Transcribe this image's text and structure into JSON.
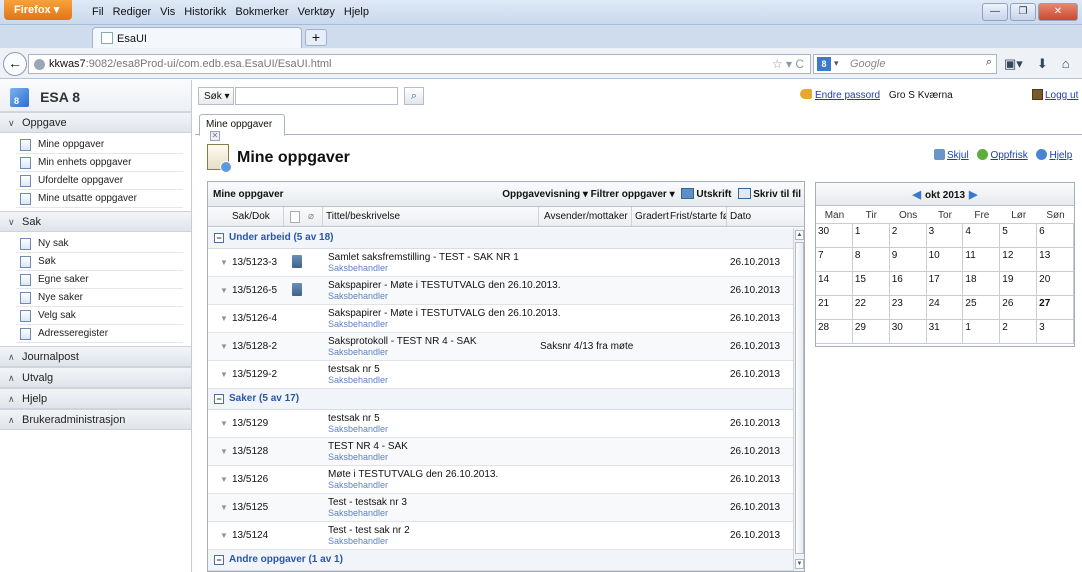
{
  "browser": {
    "menu_button": "Firefox",
    "menu_items": [
      "Fil",
      "Rediger",
      "Vis",
      "Historikk",
      "Bokmerker",
      "Verktøy",
      "Hjelp"
    ],
    "tab_title": "EsaUI",
    "new_tab": "+",
    "url_domain": "kkwas7",
    "url_path": ":9082/esa8Prod-ui/com.edb.esa.EsaUI/EsaUI.html",
    "search_placeholder": "Google"
  },
  "app": {
    "brand_name": "ESA 8",
    "brand_badge": "8",
    "search_select": "Søk",
    "change_password": "Endre passord",
    "user_name": "Gro S Kværna",
    "logout": "Logg ut"
  },
  "sidebar": {
    "sections": [
      {
        "label": "Oppgave",
        "expanded": true,
        "items": [
          "Mine oppgaver",
          "Min enhets oppgaver",
          "Ufordelte oppgaver",
          "Mine utsatte oppgaver"
        ]
      },
      {
        "label": "Sak",
        "expanded": true,
        "items": [
          "Ny sak",
          "Søk",
          "Egne saker",
          "Nye saker",
          "Velg sak",
          "Adresseregister"
        ]
      },
      {
        "label": "Journalpost",
        "expanded": false
      },
      {
        "label": "Utvalg",
        "expanded": false
      },
      {
        "label": "Hjelp",
        "expanded": false
      },
      {
        "label": "Brukeradministrasjon",
        "expanded": false
      }
    ]
  },
  "content": {
    "tab_label": "Mine oppgaver",
    "page_title": "Mine oppgaver",
    "actions": {
      "hide": "Skjul",
      "refresh": "Oppfrisk",
      "help": "Hjelp"
    }
  },
  "grid": {
    "title": "Mine oppgaver",
    "tools": {
      "view": "Oppgavevisning",
      "filter": "Filtrer oppgaver",
      "print": "Utskrift",
      "write": "Skriv til fil"
    },
    "columns": [
      "Sak/Dok",
      "Tittel/beskrivelse",
      "Avsender/mottaker",
      "Gradert",
      "Frist/starte før",
      "Dato"
    ],
    "groups": [
      {
        "label": "Under arbeid (5 av 18)",
        "rows": [
          {
            "saknr": "13/5123-3",
            "stack": true,
            "title": "Samlet saksfremstilling - TEST - SAK NR 1",
            "sub": "Saksbehandler",
            "avs": "",
            "dato": "26.10.2013"
          },
          {
            "saknr": "13/5126-5",
            "stack": true,
            "title": "Sakspapirer - Møte i TESTUTVALG den 26.10.2013.",
            "sub": "Saksbehandler",
            "avs": "",
            "dato": "26.10.2013"
          },
          {
            "saknr": "13/5126-4",
            "stack": false,
            "title": "Sakspapirer - Møte i TESTUTVALG den 26.10.2013.",
            "sub": "Saksbehandler",
            "avs": "",
            "dato": "26.10.2013"
          },
          {
            "saknr": "13/5128-2",
            "stack": false,
            "title": "Saksprotokoll - TEST NR 4 - SAK",
            "sub": "Saksbehandler",
            "avs": "Saksnr 4/13 fra møte",
            "dato": "26.10.2013"
          },
          {
            "saknr": "13/5129-2",
            "stack": false,
            "title": "testsak nr 5",
            "sub": "Saksbehandler",
            "avs": "",
            "dato": "26.10.2013"
          }
        ]
      },
      {
        "label": "Saker (5 av 17)",
        "rows": [
          {
            "saknr": "13/5129",
            "stack": false,
            "title": "testsak nr 5",
            "sub": "Saksbehandler",
            "avs": "",
            "dato": "26.10.2013"
          },
          {
            "saknr": "13/5128",
            "stack": false,
            "title": "TEST NR 4 - SAK",
            "sub": "Saksbehandler",
            "avs": "",
            "dato": "26.10.2013"
          },
          {
            "saknr": "13/5126",
            "stack": false,
            "title": "Møte i TESTUTVALG den 26.10.2013.",
            "sub": "Saksbehandler",
            "avs": "",
            "dato": "26.10.2013"
          },
          {
            "saknr": "13/5125",
            "stack": false,
            "title": "Test - testsak nr 3",
            "sub": "Saksbehandler",
            "avs": "",
            "dato": "26.10.2013"
          },
          {
            "saknr": "13/5124",
            "stack": false,
            "title": "Test - test sak nr 2",
            "sub": "Saksbehandler",
            "avs": "",
            "dato": "26.10.2013"
          }
        ]
      },
      {
        "label": "Andre oppgaver (1 av 1)",
        "rows": []
      }
    ]
  },
  "calendar": {
    "month_label": "okt 2013",
    "weekdays": [
      "Man",
      "Tir",
      "Ons",
      "Tor",
      "Fre",
      "Lør",
      "Søn"
    ],
    "days": [
      "30",
      "1",
      "2",
      "3",
      "4",
      "5",
      "6",
      "7",
      "8",
      "9",
      "10",
      "11",
      "12",
      "13",
      "14",
      "15",
      "16",
      "17",
      "18",
      "19",
      "20",
      "21",
      "22",
      "23",
      "24",
      "25",
      "26",
      "27",
      "28",
      "29",
      "30",
      "31",
      "1",
      "2",
      "3"
    ],
    "today": "27"
  }
}
